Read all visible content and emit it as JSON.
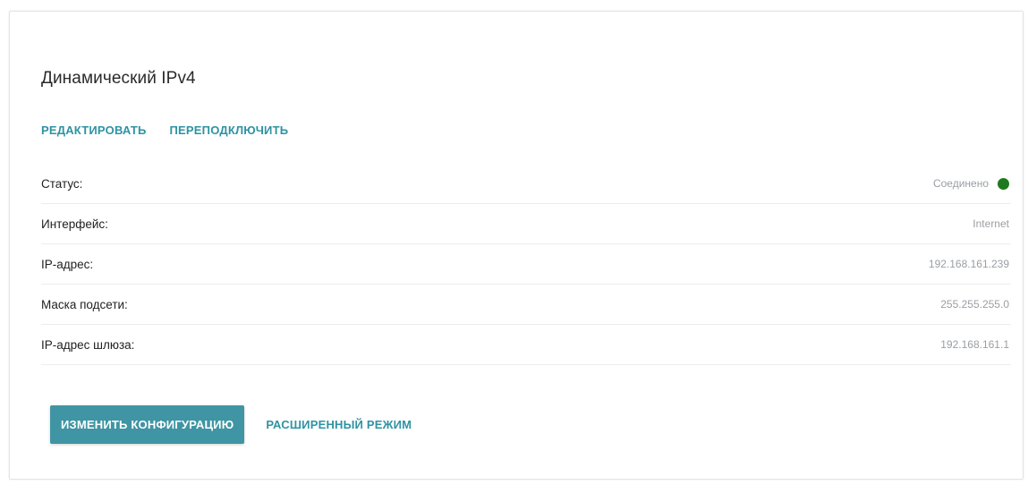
{
  "panel": {
    "title": "Динамический IPv4",
    "actions": {
      "edit": "РЕДАКТИРОВАТЬ",
      "reconnect": "ПЕРЕПОДКЛЮЧИТЬ"
    },
    "rows": [
      {
        "label": "Статус:",
        "value": "Соединено"
      },
      {
        "label": "Интерфейс:",
        "value": "Internet"
      },
      {
        "label": "IP-адрес:",
        "value": "192.168.161.239"
      },
      {
        "label": "Маска подсети:",
        "value": "255.255.255.0"
      },
      {
        "label": "IP-адрес шлюза:",
        "value": "192.168.161.1"
      }
    ],
    "status_indicator": {
      "icon": "status-dot-icon",
      "color": "#1f7a1f"
    },
    "buttons": {
      "change_config": "ИЗМЕНИТЬ КОНФИГУРАЦИЮ",
      "advanced_mode": "РАСШИРЕННЫЙ РЕЖИМ"
    }
  },
  "colors": {
    "accent": "#2e93a3",
    "primary_button": "#3f95a3",
    "status_connected": "#1f7a1f"
  }
}
